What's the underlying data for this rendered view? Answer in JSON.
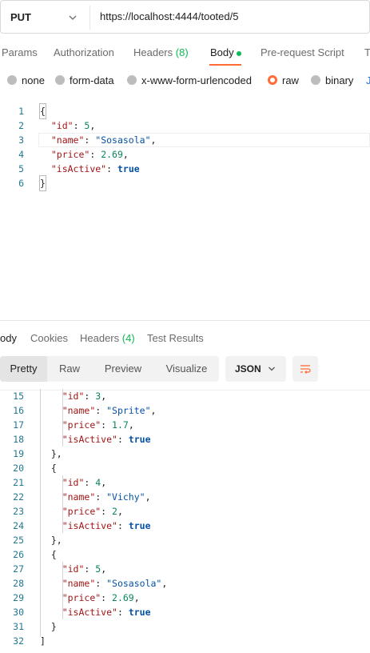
{
  "request": {
    "method": "PUT",
    "url": "https://localhost:4444/tooted/5"
  },
  "request_tabs": [
    {
      "label": "Params"
    },
    {
      "label": "Authorization"
    },
    {
      "label": "Headers",
      "count": "(8)"
    },
    {
      "label": "Body",
      "active": true
    },
    {
      "label": "Pre-request Script"
    },
    {
      "label": "Te"
    }
  ],
  "body_types": [
    {
      "label": "none",
      "selected": false
    },
    {
      "label": "form-data",
      "selected": false
    },
    {
      "label": "x-www-form-urlencoded",
      "selected": false
    },
    {
      "label": "raw",
      "selected": true
    },
    {
      "label": "binary",
      "selected": false
    },
    {
      "label": "J",
      "selected": false
    }
  ],
  "request_body": {
    "line_numbers": [
      "1",
      "2",
      "3",
      "4",
      "5",
      "6"
    ],
    "lines": [
      "{",
      "  \"id\": 5,",
      "  \"name\": \"Sosasola\",",
      "  \"price\": 2.69,",
      "  \"isActive\": true",
      "}"
    ]
  },
  "response_tabs": [
    {
      "label": "ody",
      "active": true
    },
    {
      "label": "Cookies"
    },
    {
      "label": "Headers",
      "count": "(4)"
    },
    {
      "label": "Test Results"
    }
  ],
  "response_toolbar": {
    "views": [
      "Pretty",
      "Raw",
      "Preview",
      "Visualize"
    ],
    "active_view": "Pretty",
    "format": "JSON"
  },
  "response_body": {
    "line_numbers": [
      "15",
      "16",
      "17",
      "18",
      "19",
      "20",
      "21",
      "22",
      "23",
      "24",
      "25",
      "26",
      "27",
      "28",
      "29",
      "30",
      "31",
      "32"
    ],
    "lines": [
      "    \"id\": 3,",
      "    \"name\": \"Sprite\",",
      "    \"price\": 1.7,",
      "    \"isActive\": true",
      "  },",
      "  {",
      "    \"id\": 4,",
      "    \"name\": \"Vichy\",",
      "    \"price\": 2,",
      "    \"isActive\": true",
      "  },",
      "  {",
      "    \"id\": 5,",
      "    \"name\": \"Sosasola\",",
      "    \"price\": 2.69,",
      "    \"isActive\": true",
      "  }",
      "]"
    ]
  },
  "colors": {
    "accent": "#ff6c37",
    "count_green": "#0cbb52",
    "json_key": "#a31515",
    "json_string": "#0451a5",
    "json_number": "#098658",
    "line_number": "#237893"
  }
}
